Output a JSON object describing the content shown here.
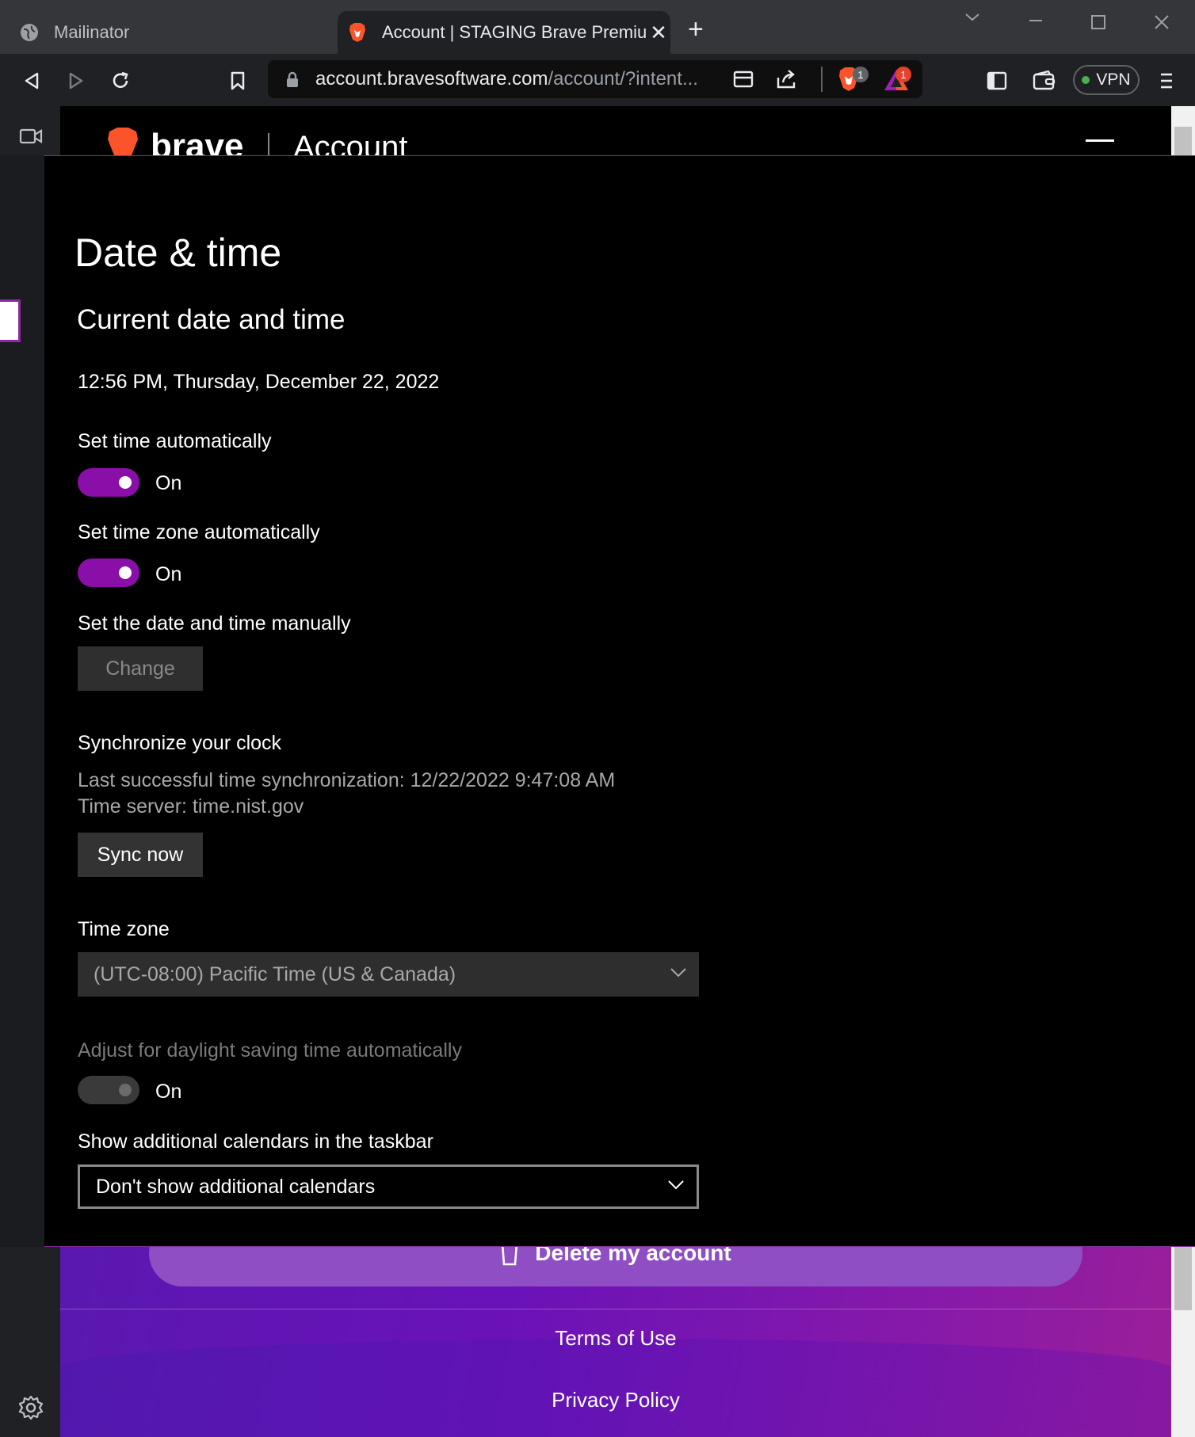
{
  "browser": {
    "tabs": [
      {
        "title": "Mailinator",
        "active": false
      },
      {
        "title": "Account | STAGING Brave Premiu",
        "active": true
      }
    ],
    "url_host": "account.bravesoftware.com",
    "url_path": "/account/?intent...",
    "shields_badge": "1",
    "rewards_badge": "1",
    "vpn_label": "VPN"
  },
  "page": {
    "logo_text": "brave",
    "header_title": "Account",
    "delete_button": "Delete my account",
    "footer_links": [
      "Terms of Use",
      "Privacy Policy"
    ]
  },
  "settings": {
    "title": "Date & time",
    "section_title": "Current date and time",
    "current_datetime": "12:56 PM, Thursday, December 22, 2022",
    "set_time_auto": {
      "label": "Set time automatically",
      "state": "On"
    },
    "set_timezone_auto": {
      "label": "Set time zone automatically",
      "state": "On"
    },
    "manual": {
      "label": "Set the date and time manually",
      "button": "Change"
    },
    "sync": {
      "label": "Synchronize your clock",
      "last_sync": "Last successful time synchronization: 12/22/2022 9:47:08 AM",
      "server": "Time server: time.nist.gov",
      "button": "Sync now"
    },
    "timezone": {
      "label": "Time zone",
      "value": "(UTC-08:00) Pacific Time (US & Canada)"
    },
    "dst": {
      "label": "Adjust for daylight saving time automatically",
      "state": "On"
    },
    "calendars": {
      "label": "Show additional calendars in the taskbar",
      "value": "Don't show additional calendars"
    }
  },
  "colors": {
    "toggle_on": "#8a0fa8",
    "accent_purple": "#6a12b8"
  }
}
